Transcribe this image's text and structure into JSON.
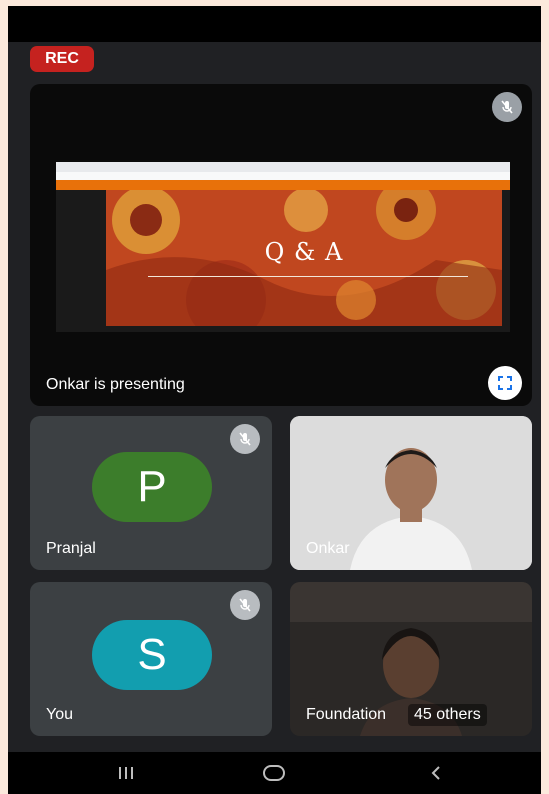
{
  "rec_badge": "REC",
  "presentation": {
    "presenter_label": "Onkar is presenting",
    "slide_title": "Q & A"
  },
  "participants": [
    {
      "name": "Pranjal",
      "initial": "P",
      "avatar_color": "#3c7d2b",
      "muted": true
    },
    {
      "name": "Onkar",
      "muted": false
    },
    {
      "name": "You",
      "initial": "S",
      "avatar_color": "#129eaf",
      "muted": true
    },
    {
      "name": "Foundation",
      "muted": false
    }
  ],
  "others_count": "45 others",
  "icons": [
    "mic-off-icon",
    "fullscreen-icon",
    "recents-icon",
    "home-icon",
    "back-icon"
  ],
  "colors": {
    "rec": "#c5221f",
    "background": "#202124",
    "tile": "#3c4043"
  }
}
